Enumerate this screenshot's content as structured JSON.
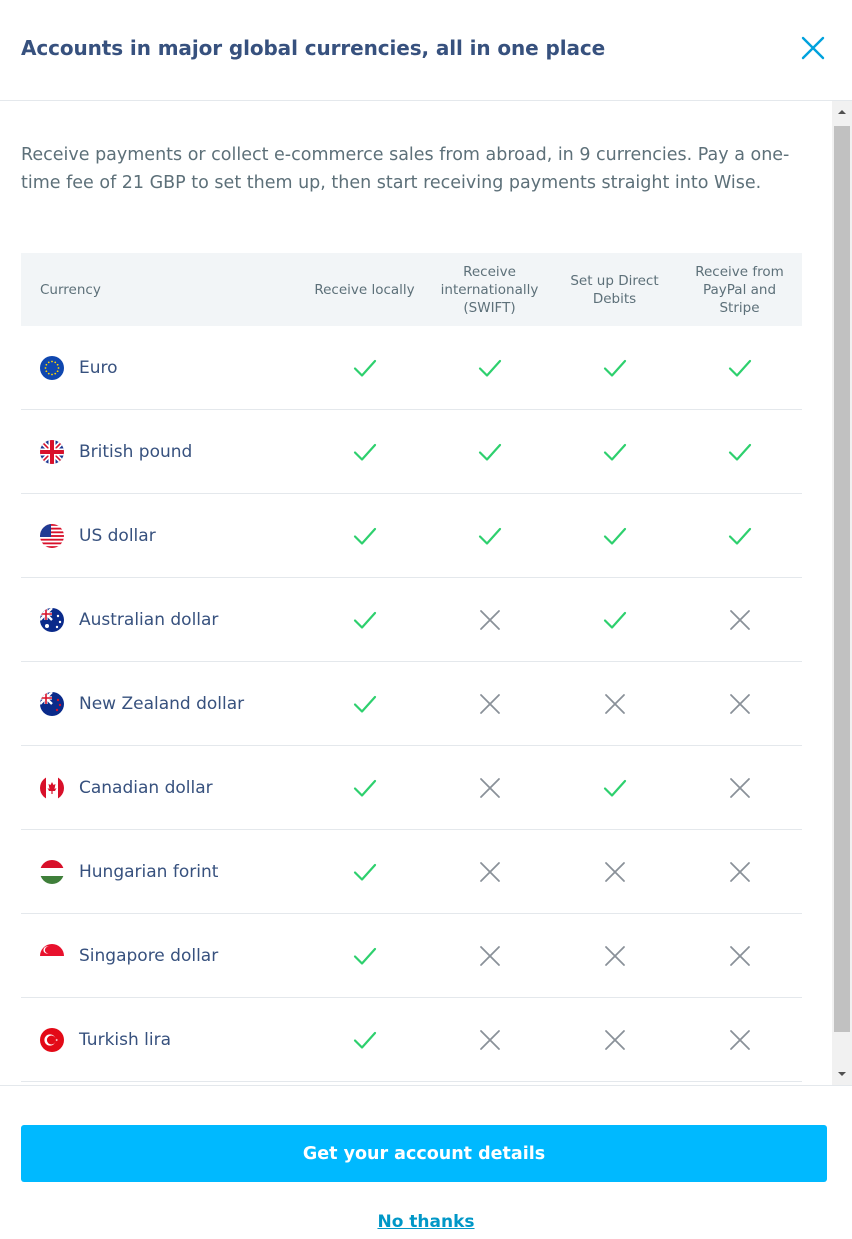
{
  "dialog": {
    "title": "Accounts in major global currencies, all in one place",
    "intro": "Receive payments or collect e-commerce sales from abroad, in 9 currencies. Pay a one-time fee of 21 GBP to set them up, then start receiving payments straight into Wise."
  },
  "table": {
    "headers": [
      "Currency",
      "Receive locally",
      "Receive internationally (SWIFT)",
      "Set up Direct Debits",
      "Receive from PayPal and Stripe"
    ],
    "rows": [
      {
        "currency": "Euro",
        "flag": "eu-flag",
        "values": [
          true,
          true,
          true,
          true
        ]
      },
      {
        "currency": "British pound",
        "flag": "gb-flag",
        "values": [
          true,
          true,
          true,
          true
        ]
      },
      {
        "currency": "US dollar",
        "flag": "us-flag",
        "values": [
          true,
          true,
          true,
          true
        ]
      },
      {
        "currency": "Australian dollar",
        "flag": "au-flag",
        "values": [
          true,
          false,
          true,
          false
        ]
      },
      {
        "currency": "New Zealand dollar",
        "flag": "nz-flag",
        "values": [
          true,
          false,
          false,
          false
        ]
      },
      {
        "currency": "Canadian dollar",
        "flag": "ca-flag",
        "values": [
          true,
          false,
          true,
          false
        ]
      },
      {
        "currency": "Hungarian forint",
        "flag": "hu-flag",
        "values": [
          true,
          false,
          false,
          false
        ]
      },
      {
        "currency": "Singapore dollar",
        "flag": "sg-flag",
        "values": [
          true,
          false,
          false,
          false
        ]
      },
      {
        "currency": "Turkish lira",
        "flag": "tr-flag",
        "values": [
          true,
          false,
          false,
          false
        ]
      }
    ]
  },
  "footer": {
    "cta_label": "Get your account details",
    "dismiss_label": "No thanks"
  },
  "colors": {
    "accent": "#00b9ff",
    "check": "#2ed06e",
    "cross": "#8a9199",
    "title": "#37517e",
    "link": "#0097c7"
  }
}
